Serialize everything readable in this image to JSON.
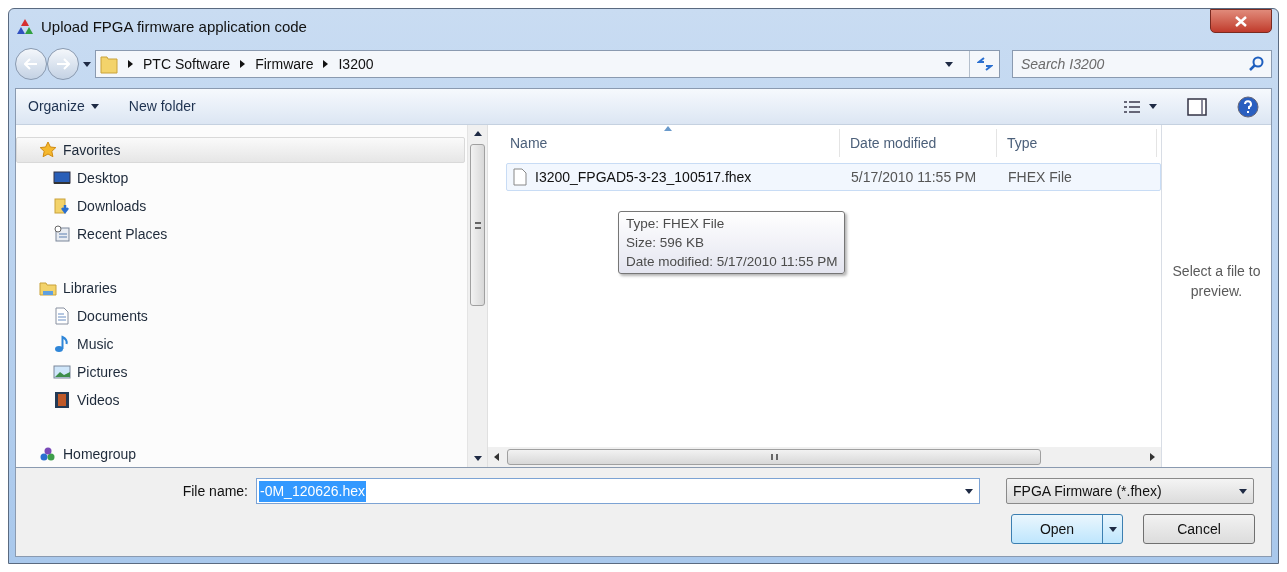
{
  "window": {
    "title": "Upload FPGA firmware application code"
  },
  "address": {
    "breadcrumbs": [
      "PTC Software",
      "Firmware",
      "I3200"
    ]
  },
  "search": {
    "placeholder": "Search I3200"
  },
  "toolbar": {
    "buttons": [
      {
        "label": "Organize",
        "kind": "menu"
      },
      {
        "label": "New folder",
        "kind": "plain"
      }
    ]
  },
  "sidebar": {
    "items": [
      {
        "label": "Favorites",
        "kind": "star",
        "selected": true,
        "children": [
          {
            "label": "Desktop",
            "kind": "desktop",
            "selected": false
          },
          {
            "label": "Downloads",
            "kind": "downloads",
            "selected": false
          },
          {
            "label": "Recent Places",
            "kind": "recent",
            "selected": false
          }
        ]
      },
      {
        "label": "Libraries",
        "kind": "libraries",
        "selected": false,
        "children": [
          {
            "label": "Documents",
            "kind": "documents",
            "selected": false
          },
          {
            "label": "Music",
            "kind": "music",
            "selected": false
          },
          {
            "label": "Pictures",
            "kind": "pictures",
            "selected": false
          },
          {
            "label": "Videos",
            "kind": "videos",
            "selected": false
          }
        ]
      },
      {
        "label": "Homegroup",
        "kind": "homegroup",
        "selected": false
      }
    ]
  },
  "table": {
    "columns": [
      {
        "label": "Name",
        "sorted": true
      },
      {
        "label": "Date modified",
        "sorted": false
      },
      {
        "label": "Type",
        "sorted": false
      }
    ],
    "rows": [
      {
        "cells": [
          "I3200_FPGAD5-3-23_100517.fhex",
          "5/17/2010 11:55 PM",
          "FHEX File"
        ],
        "selected": true
      }
    ]
  },
  "tooltip": {
    "lines": [
      "Type: FHEX File",
      "Size: 596 KB",
      "Date modified: 5/17/2010 11:55 PM"
    ]
  },
  "preview": {
    "message": "Select a file to preview."
  },
  "file_name": {
    "label": "File name:",
    "value": "-0M_120626.hex",
    "text_selected": true
  },
  "file_type": {
    "value": "FPGA Firmware (*.fhex)"
  },
  "buttons": [
    {
      "label": "Open",
      "kind": "split",
      "selected": true
    },
    {
      "label": "Cancel",
      "kind": "plain",
      "selected": false
    }
  ]
}
